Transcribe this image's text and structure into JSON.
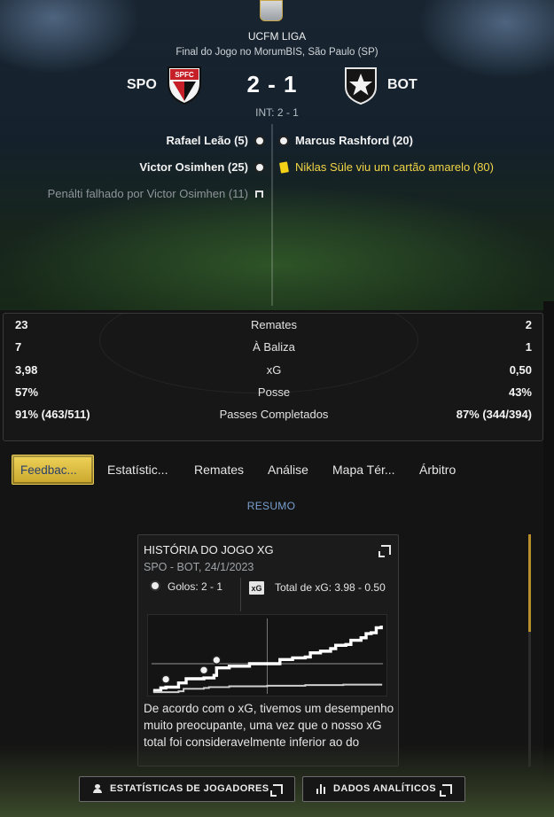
{
  "header": {
    "league": "UCFM LIGA",
    "venue": "Final do Jogo no MorumBIS, São Paulo (SP)",
    "home_abbr": "SPO",
    "away_abbr": "BOT",
    "score": "2 - 1",
    "halftime": "INT: 2 - 1",
    "home_crest_text": "SPFC",
    "colors": {
      "home_red": "#d0202a",
      "home_black": "#111111",
      "away_black": "#1a1a1a",
      "yellow_card": "#f4d016"
    }
  },
  "events": {
    "home": [
      {
        "text": "Rafael Leão (5)",
        "icon": "goal-ball-icon"
      },
      {
        "text": "Victor Osimhen (25)",
        "icon": "goal-ball-icon"
      },
      {
        "text": "Penálti falhado por Victor Osimhen (11)",
        "icon": "missed-penalty-icon"
      }
    ],
    "away": [
      {
        "text": "Marcus Rashford (20)",
        "icon": "goal-ball-icon"
      },
      {
        "text": "Niklas Süle viu um cartão amarelo (80)",
        "icon": "yellow-card-icon"
      }
    ]
  },
  "stats": [
    {
      "home": "23",
      "label": "Remates",
      "away": "2"
    },
    {
      "home": "7",
      "label": "À Baliza",
      "away": "1"
    },
    {
      "home": "3,98",
      "label": "xG",
      "away": "0,50"
    },
    {
      "home": "57%",
      "label": "Posse",
      "away": "43%"
    },
    {
      "home": "91% (463/511)",
      "label": "Passes Completados",
      "away": "87% (344/394)"
    }
  ],
  "tabs": [
    "Feedbac...",
    "Estatístic...",
    "Remates",
    "Análise",
    "Mapa Tér...",
    "Árbitro"
  ],
  "active_tab": 0,
  "summary_label": "RESUMO",
  "xg_card": {
    "title": "HISTÓRIA DO JOGO XG",
    "subtitle": "SPO - BOT, 24/1/2023",
    "goals_text": "Golos: 2 - 1",
    "xg_icon_text": "xG",
    "total_xg_text": "Total de xG: 3.98 - 0.50",
    "body": "De acordo com o xG, tivemos um desempenho muito preocupante, uma vez que o nosso xG total foi consideravelmente inferior ao do"
  },
  "chart_data": {
    "type": "line",
    "title": "HISTÓRIA DO JOGO XG",
    "xlim": [
      0,
      90
    ],
    "ylim": [
      0,
      4.2
    ],
    "xlabel": "",
    "ylabel": "",
    "grid": false,
    "half_time_marker": 45,
    "series": [
      {
        "color": "#ffffff",
        "points": [
          [
            0,
            0.1
          ],
          [
            3,
            0.25
          ],
          [
            5,
            0.3
          ],
          [
            10,
            0.55
          ],
          [
            13,
            0.8
          ],
          [
            20,
            0.85
          ],
          [
            24,
            1.0
          ],
          [
            25,
            1.45
          ],
          [
            30,
            1.55
          ],
          [
            36,
            1.55
          ],
          [
            38,
            1.7
          ],
          [
            45,
            1.7
          ],
          [
            50,
            1.95
          ],
          [
            55,
            2.05
          ],
          [
            60,
            2.1
          ],
          [
            62,
            2.35
          ],
          [
            66,
            2.45
          ],
          [
            70,
            2.6
          ],
          [
            72,
            2.8
          ],
          [
            76,
            2.85
          ],
          [
            78,
            3.1
          ],
          [
            82,
            3.25
          ],
          [
            84,
            3.5
          ],
          [
            86,
            3.55
          ],
          [
            88,
            3.85
          ],
          [
            90,
            3.98
          ]
        ]
      },
      {
        "color": "#cfcfcf",
        "points": [
          [
            0,
            0
          ],
          [
            10,
            0.05
          ],
          [
            12,
            0.2
          ],
          [
            20,
            0.25
          ],
          [
            22,
            0.3
          ],
          [
            30,
            0.35
          ],
          [
            45,
            0.38
          ],
          [
            60,
            0.42
          ],
          [
            75,
            0.45
          ],
          [
            90,
            0.5
          ]
        ]
      }
    ],
    "goal_markers": [
      {
        "minute": 5,
        "xg": 0.3
      },
      {
        "minute": 20,
        "xg": 0.85
      },
      {
        "minute": 25,
        "xg": 1.45
      }
    ]
  },
  "buttons": {
    "player_stats": "ESTATÍSTICAS DE JOGADORES",
    "analytics": "DADOS ANALÍTICOS"
  }
}
